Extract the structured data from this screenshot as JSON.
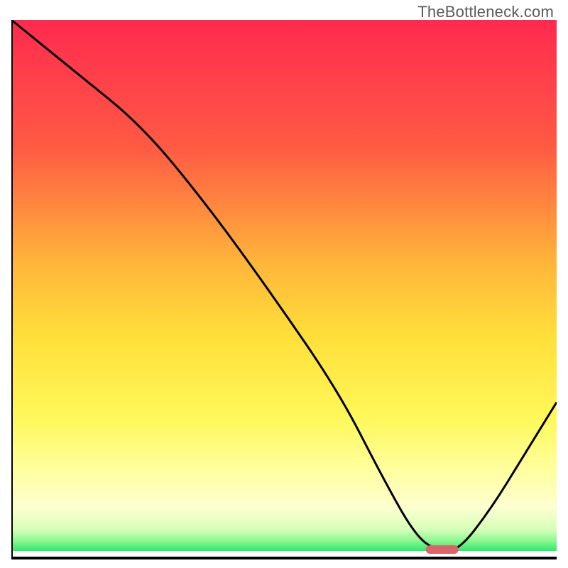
{
  "watermark": "TheBottleneck.com",
  "chart_data": {
    "type": "line",
    "title": "",
    "xlabel": "",
    "ylabel": "",
    "xlim": [
      0,
      100
    ],
    "ylim": [
      0,
      100
    ],
    "grid": false,
    "legend": false,
    "background_gradient": {
      "top_color": "#ff2a4f",
      "mid_colors": [
        "#ff7a3a",
        "#ffd83a",
        "#fff85a",
        "#f8ff9a"
      ],
      "bottom_color": "#2ee86b"
    },
    "series": [
      {
        "name": "bottleneck-curve",
        "color": "#000000",
        "x": [
          0,
          12,
          24,
          36,
          48,
          60,
          68,
          74,
          78,
          82,
          88,
          94,
          100
        ],
        "y": [
          100,
          90,
          80,
          65,
          48,
          30,
          14,
          3,
          0,
          0,
          8,
          18,
          28
        ]
      }
    ],
    "marker": {
      "name": "optimal-range",
      "x_start": 76,
      "x_end": 82,
      "y": 0.5,
      "color": "#d9646b"
    }
  }
}
